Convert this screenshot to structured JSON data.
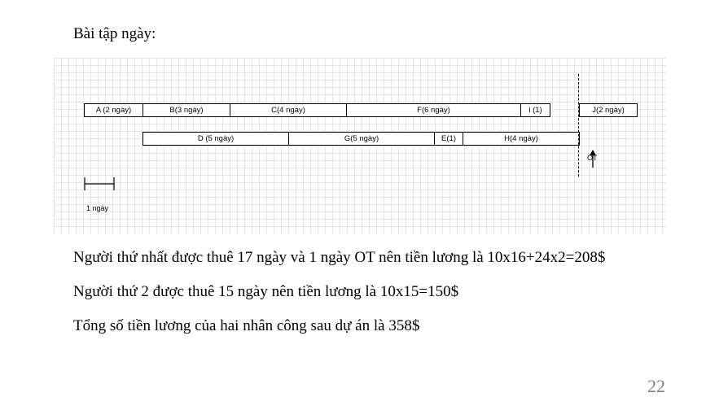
{
  "heading": "Bài tập ngày:",
  "diagram": {
    "row1": [
      "A (2 ngày)",
      "B(3 ngày)",
      "C(4 ngày)",
      "F(6 ngày)",
      "i (1)",
      "J(2 ngày)"
    ],
    "row2": [
      "D (5 ngày)",
      "G(5 ngày)",
      "E(1)",
      "H(4 ngày)"
    ],
    "ot_label": "OT",
    "scale_label": "1 ngày"
  },
  "lines": [
    "Người thứ nhất được thuê 17 ngày và 1 ngày OT nên tiền lương là 10x16+24x2=208$",
    "Người thứ 2 được thuê 15 ngày nên tiền lương là 10x15=150$",
    "Tổng số tiền lương của hai nhân công sau dự án là 358$"
  ],
  "page_number": "22"
}
